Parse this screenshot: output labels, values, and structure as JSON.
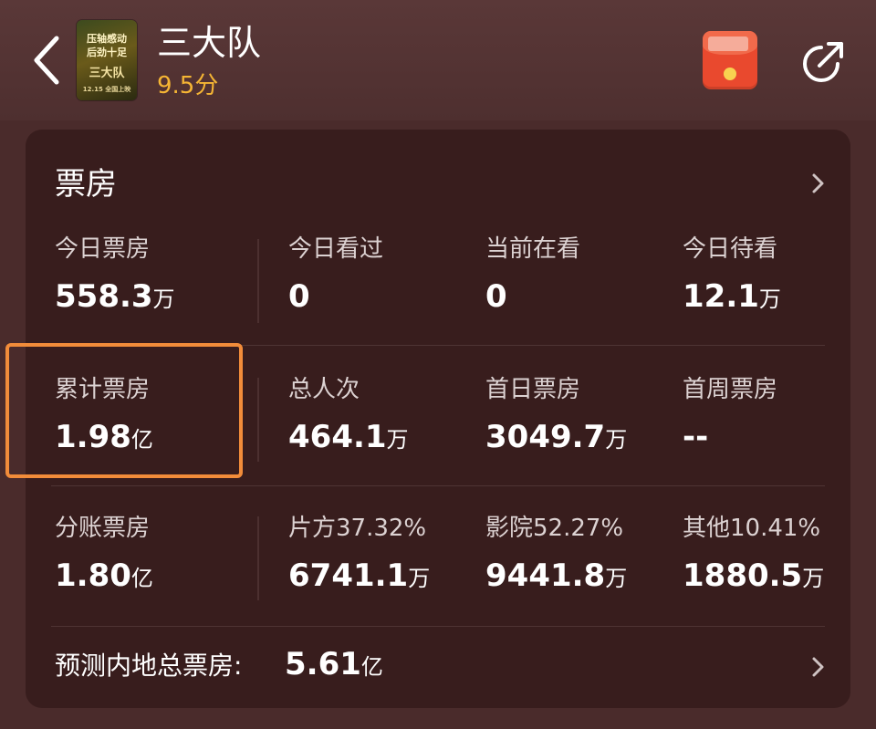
{
  "header": {
    "title": "三大队",
    "score": "9.5分",
    "poster": {
      "line1": "压轴感动",
      "line2": "后劲十足",
      "line3": "三大队",
      "line4": "12.15 全国上映"
    }
  },
  "card": {
    "title": "票房",
    "rows": [
      [
        {
          "label": "今日票房",
          "value": "558.3",
          "unit": "万"
        },
        {
          "label": "今日看过",
          "value": "0",
          "unit": ""
        },
        {
          "label": "当前在看",
          "value": "0",
          "unit": ""
        },
        {
          "label": "今日待看",
          "value": "12.1",
          "unit": "万"
        }
      ],
      [
        {
          "label": "累计票房",
          "value": "1.98",
          "unit": "亿"
        },
        {
          "label": "总人次",
          "value": "464.1",
          "unit": "万"
        },
        {
          "label": "首日票房",
          "value": "3049.7",
          "unit": "万"
        },
        {
          "label": "首周票房",
          "value": "--",
          "unit": ""
        }
      ],
      [
        {
          "label": "分账票房",
          "value": "1.80",
          "unit": "亿"
        },
        {
          "label": "片方37.32%",
          "value": "6741.1",
          "unit": "万"
        },
        {
          "label": "影院52.27%",
          "value": "9441.8",
          "unit": "万"
        },
        {
          "label": "其他10.41%",
          "value": "1880.5",
          "unit": "万"
        }
      ]
    ]
  },
  "forecast": {
    "label": "预测内地总票房:",
    "value": "5.61",
    "unit": "亿"
  },
  "colors": {
    "background": "#4a2b2b",
    "card": "#381d1d",
    "score": "#f5b534",
    "highlight": "#f28c3a",
    "red_packet": "#e9492e"
  },
  "icons": [
    "back-arrow-icon",
    "red-packet-icon",
    "share-icon",
    "chevron-right-icon"
  ]
}
